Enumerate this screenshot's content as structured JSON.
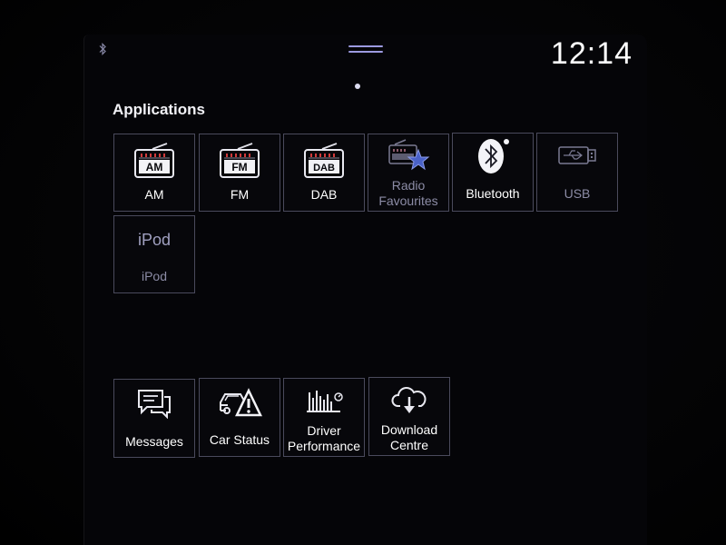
{
  "status": {
    "time": "12:14",
    "bluetooth_icon": "bluetooth-icon"
  },
  "section": {
    "title": "Applications"
  },
  "apps": [
    {
      "id": "am",
      "label": "AM",
      "badge": "AM",
      "icon": "am-radio-icon",
      "state": "active"
    },
    {
      "id": "fm",
      "label": "FM",
      "badge": "FM",
      "icon": "fm-radio-icon",
      "state": "active"
    },
    {
      "id": "dab",
      "label": "DAB",
      "badge": "DAB",
      "icon": "dab-radio-icon",
      "state": "active"
    },
    {
      "id": "radio-favourites",
      "label_line1": "Radio",
      "label_line2": "Favourites",
      "icon": "radio-star-icon",
      "state": "dim"
    },
    {
      "id": "bluetooth",
      "label": "Bluetooth",
      "icon": "bluetooth-icon",
      "state": "active"
    },
    {
      "id": "usb",
      "label": "USB",
      "icon": "usb-drive-icon",
      "state": "dim"
    },
    {
      "id": "ipod",
      "label": "iPod",
      "title": "iPod",
      "icon": "ipod-text-icon",
      "state": "dim"
    }
  ],
  "tools": [
    {
      "id": "messages",
      "label": "Messages",
      "icon": "messages-icon"
    },
    {
      "id": "car-status",
      "label": "Car Status",
      "icon": "car-warning-icon"
    },
    {
      "id": "driver-performance",
      "label_line1": "Driver",
      "label_line2": "Performance",
      "icon": "performance-chart-icon"
    },
    {
      "id": "download-centre",
      "label_line1": "Download",
      "label_line2": "Centre",
      "icon": "cloud-download-icon"
    }
  ],
  "colors": {
    "accent": "#9c9ae0",
    "tile_border": "#4a4a5c",
    "dim_text": "#8c8ca6",
    "radio_red": "#d23a3a"
  }
}
